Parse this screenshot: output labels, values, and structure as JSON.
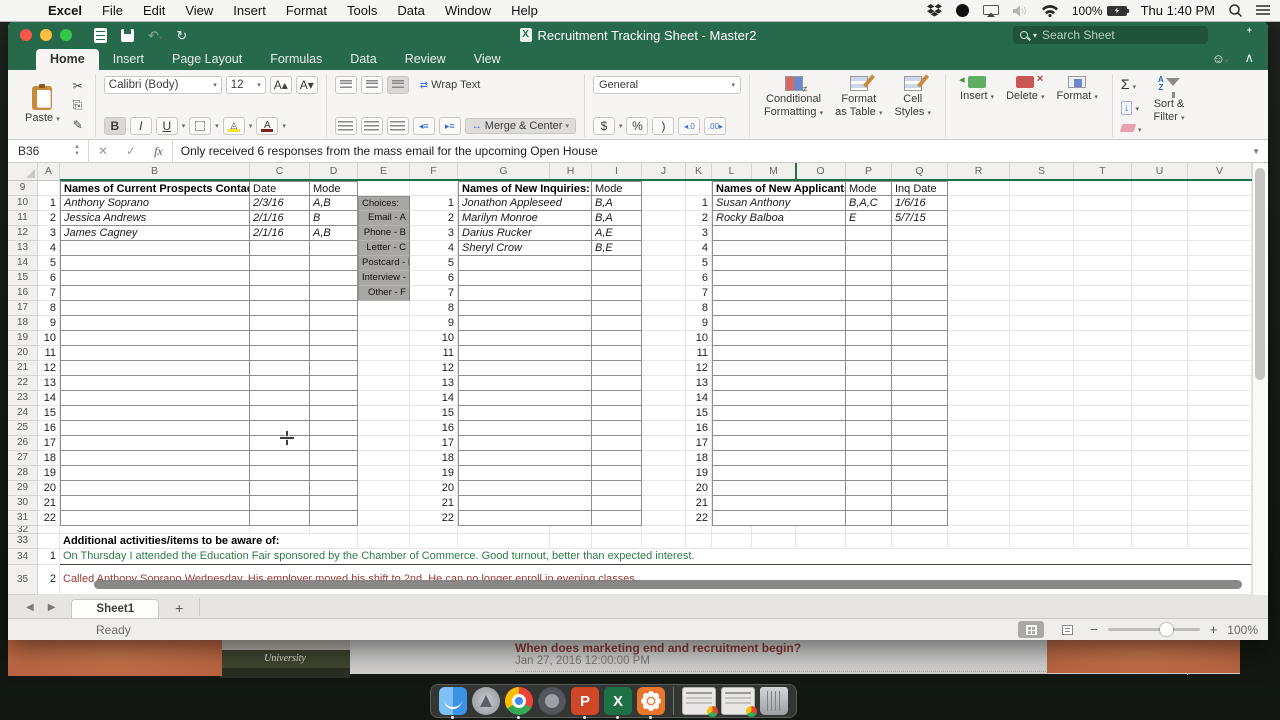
{
  "menu_bar": {
    "apple": "",
    "items": [
      "Excel",
      "File",
      "Edit",
      "View",
      "Insert",
      "Format",
      "Tools",
      "Data",
      "Window",
      "Help"
    ],
    "status": {
      "battery_pct": "100%",
      "clock": "Thu 1:40 PM"
    }
  },
  "title_bar": {
    "title": "Recruitment Tracking Sheet - Master2",
    "search_placeholder": "Search Sheet"
  },
  "ribbon": {
    "tabs": [
      "Home",
      "Insert",
      "Page Layout",
      "Formulas",
      "Data",
      "Review",
      "View"
    ],
    "active_tab": "Home",
    "clipboard": {
      "paste": "Paste"
    },
    "font": {
      "name": "Calibri (Body)",
      "size": "12"
    },
    "alignment": {
      "wrap_text": "Wrap Text",
      "merge_center": "Merge & Center"
    },
    "number": {
      "format": "General",
      "currency": "$",
      "percent": "%",
      "comma": ")",
      "inc_decimal": "◂.0",
      "dec_decimal": ".00▸"
    },
    "styles": {
      "conditional_line1": "Conditional",
      "conditional_line2": "Formatting",
      "format_table_line1": "Format",
      "format_table_line2": "as Table",
      "cell_styles_line1": "Cell",
      "cell_styles_line2": "Styles"
    },
    "cells": {
      "insert": "Insert",
      "delete": "Delete",
      "format": "Format"
    },
    "editing": {
      "autosum": "Σ",
      "sort_line1": "Sort &",
      "sort_line2": "Filter"
    }
  },
  "formula_bar": {
    "name_box": "B36",
    "fx": "fx",
    "value": "Only received 6 responses from the mass email for the upcoming Open House"
  },
  "grid": {
    "columns": [
      "A",
      "B",
      "C",
      "D",
      "E",
      "F",
      "G",
      "H",
      "I",
      "J",
      "K",
      "L",
      "M",
      "O",
      "P",
      "Q",
      "R",
      "S",
      "T",
      "U",
      "V"
    ],
    "rows_start": 9,
    "rows_end": 35,
    "numbered_count": 22,
    "prospects": {
      "title": "Names of Current Prospects Contacted:",
      "date_header": "Date",
      "mode_header": "Mode",
      "entries": [
        {
          "n": "1",
          "name": "Anthony Soprano",
          "date": "2/3/16",
          "mode": "A,B"
        },
        {
          "n": "2",
          "name": "Jessica Andrews",
          "date": "2/1/16",
          "mode": "B"
        },
        {
          "n": "3",
          "name": "James Cagney",
          "date": "2/1/16",
          "mode": "A,B"
        }
      ]
    },
    "choices": {
      "title": "Choices:",
      "items": [
        "Email - A",
        "Phone - B",
        "Letter - C",
        "Postcard - D",
        "Interview - E",
        "Other - F"
      ]
    },
    "inquiries": {
      "title": "Names of New Inquiries:",
      "mode_header": "Mode",
      "entries": [
        {
          "n": "1",
          "name": "Jonathon Appleseed",
          "mode": "B,A"
        },
        {
          "n": "2",
          "name": "Marilyn Monroe",
          "mode": "B,A"
        },
        {
          "n": "3",
          "name": "Darius Rucker",
          "mode": "A,E"
        },
        {
          "n": "4",
          "name": "Sheryl Crow",
          "mode": "B,E"
        }
      ]
    },
    "applicants": {
      "title": "Names of New Applicants:",
      "mode_header": "Mode",
      "inq_date_header": "Inq Date",
      "entries": [
        {
          "n": "1",
          "name": "Susan Anthony",
          "mode": "B,A,C",
          "inq_date": "1/6/16"
        },
        {
          "n": "2",
          "name": "Rocky Balboa",
          "mode": "E",
          "inq_date": "5/7/15"
        }
      ]
    },
    "notes": {
      "title": "Additional activities/items to be aware of:",
      "entries": [
        {
          "n": "1",
          "text": "On Thursday I attended the Education Fair sponsored by the Chamber of Commerce. Good turnout, better than expected interest.",
          "color": "#2e7d45"
        },
        {
          "n": "2",
          "text": "Called Anthony Soprano Wednesday. His employer moved his shift to 2nd. He can no longer enroll in evening classes.",
          "color": "#9c3a31"
        }
      ]
    }
  },
  "sheet_bar": {
    "tabs": [
      "Sheet1"
    ],
    "add_label": "+"
  },
  "status_bar": {
    "status": "Ready",
    "zoom": "100%"
  },
  "background_window": {
    "question": "When does marketing end and recruitment begin?",
    "timestamp": "Jan 27, 2016 12:00:00 PM",
    "university_caption": "University"
  },
  "dock": {
    "items": [
      {
        "name": "finder",
        "running": true
      },
      {
        "name": "launchpad",
        "running": false
      },
      {
        "name": "chrome",
        "running": true
      },
      {
        "name": "system-preferences",
        "running": false
      },
      {
        "name": "powerpoint",
        "running": true
      },
      {
        "name": "excel",
        "running": true
      },
      {
        "name": "gotomeeting",
        "running": true
      },
      {
        "name": "separator",
        "running": false
      },
      {
        "name": "minimized-window-1",
        "running": false
      },
      {
        "name": "minimized-window-2",
        "running": false
      },
      {
        "name": "trash",
        "running": false
      }
    ]
  },
  "colors": {
    "excel_green": "#276a4b",
    "freeze_line": "#1f7044",
    "orange_panel": "#c4714b",
    "note_green": "#2e7d45",
    "note_red": "#9c3a31"
  }
}
